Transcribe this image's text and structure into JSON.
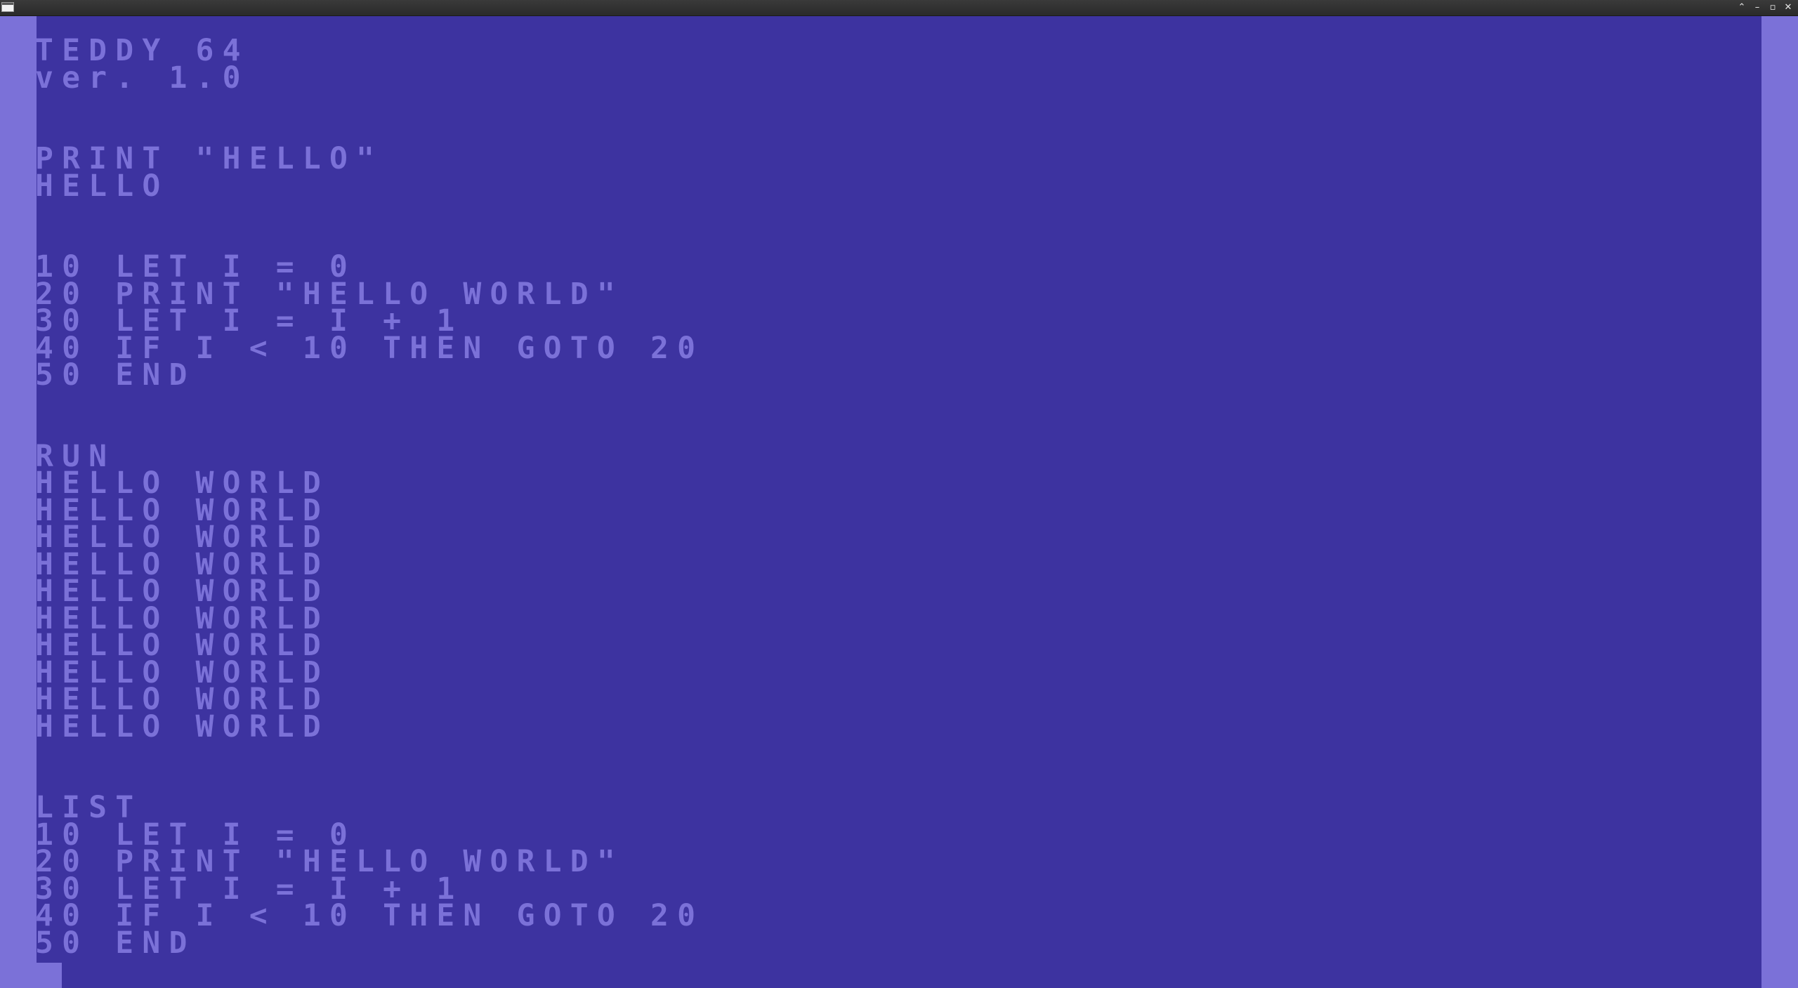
{
  "window": {
    "controls": {
      "minimize_restore": "⌃",
      "minimize": "–",
      "maximize": "▫",
      "close": "✕"
    }
  },
  "screen": {
    "colors": {
      "background": "#3d33a0",
      "border": "#7b71d8",
      "text": "#7b71d8"
    },
    "lines": [
      "TEDDY 64",
      "ver. 1.0",
      "",
      "",
      "PRINT \"HELLO\"",
      "HELLO",
      "",
      "",
      "10 LET I = 0",
      "20 PRINT \"HELLO WORLD\"",
      "30 LET I = I + 1",
      "40 IF I < 10 THEN GOTO 20",
      "50 END",
      "",
      "",
      "RUN",
      "HELLO WORLD",
      "HELLO WORLD",
      "HELLO WORLD",
      "HELLO WORLD",
      "HELLO WORLD",
      "HELLO WORLD",
      "HELLO WORLD",
      "HELLO WORLD",
      "HELLO WORLD",
      "HELLO WORLD",
      "",
      "",
      "LIST",
      "10 LET I = 0",
      "20 PRINT \"HELLO WORLD\"",
      "30 LET I = I + 1",
      "40 IF I < 10 THEN GOTO 20",
      "50 END"
    ]
  }
}
